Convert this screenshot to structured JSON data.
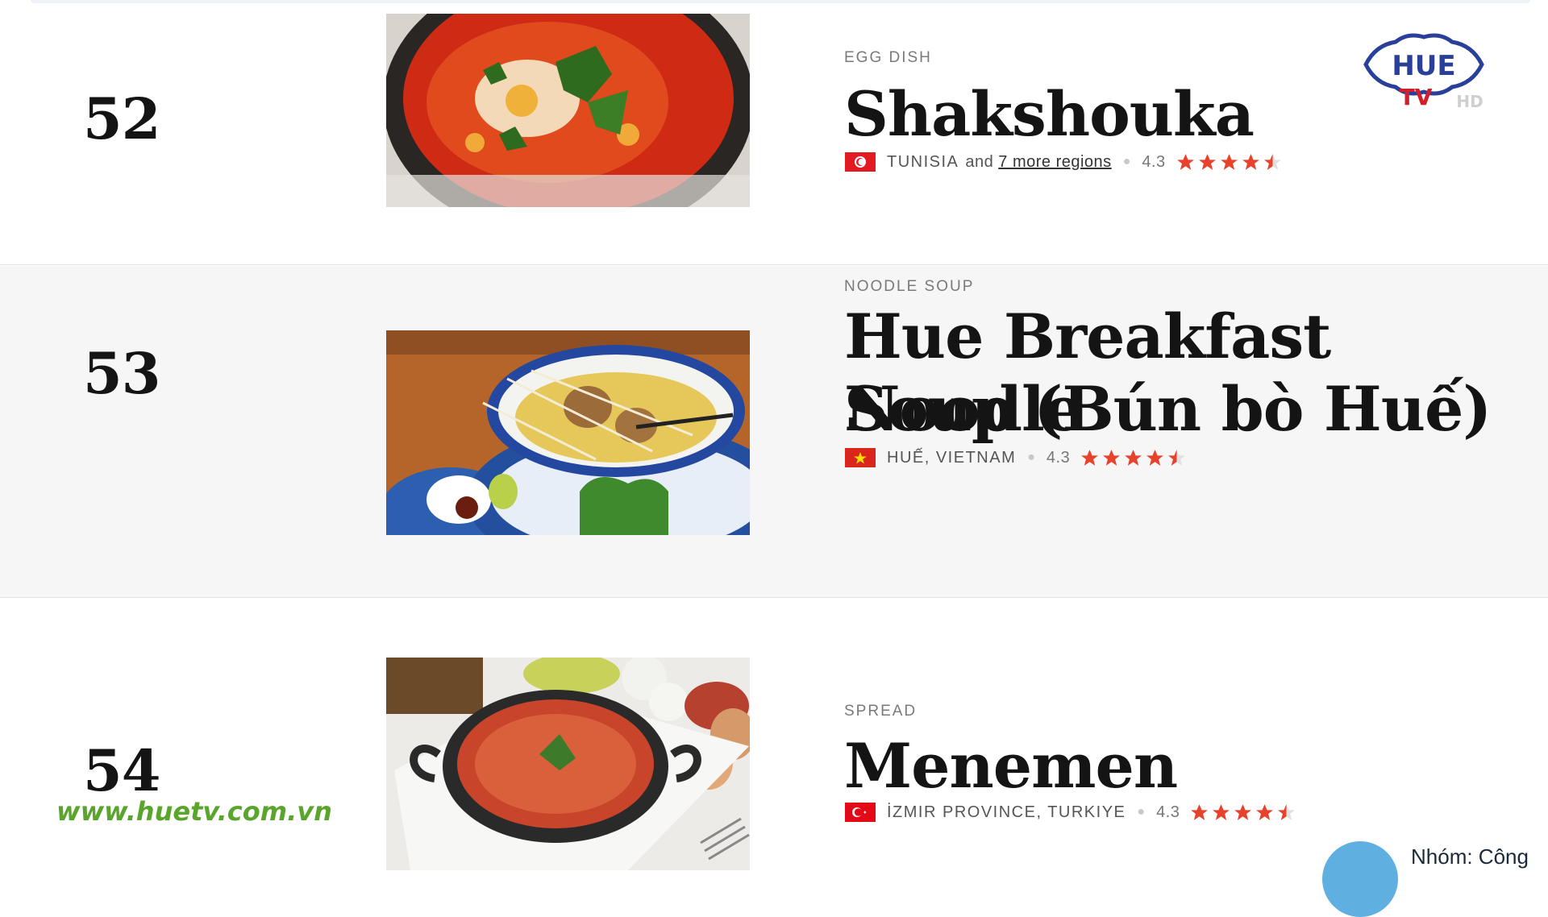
{
  "items": [
    {
      "rank": "52",
      "category": "EGG DISH",
      "title": "Shakshouka",
      "region": "TUNISIA",
      "region_and": "and",
      "more_regions": "7 more regions",
      "rating": "4.3",
      "stars": 4.3
    },
    {
      "rank": "53",
      "category": "NOODLE SOUP",
      "title_line1": "Hue Breakfast Noodle",
      "title_line2": "Soup (Bún bò Huế)",
      "region": "HUẾ, VIETNAM",
      "rating": "4.3",
      "stars": 4.3
    },
    {
      "rank": "54",
      "category": "SPREAD",
      "title": "Menemen",
      "region": "İZMIR PROVINCE, TURKIYE",
      "rating": "4.3",
      "stars": 4.3
    }
  ],
  "logo": {
    "main": "HUE",
    "sub": "TV",
    "hd": "HD"
  },
  "watermark": "www.huetv.com.vn",
  "group_badge": "Nhóm: Công",
  "colors": {
    "star": "#e8412c",
    "watermark": "#5aa52c",
    "logo_blue": "#2a3f9a"
  }
}
